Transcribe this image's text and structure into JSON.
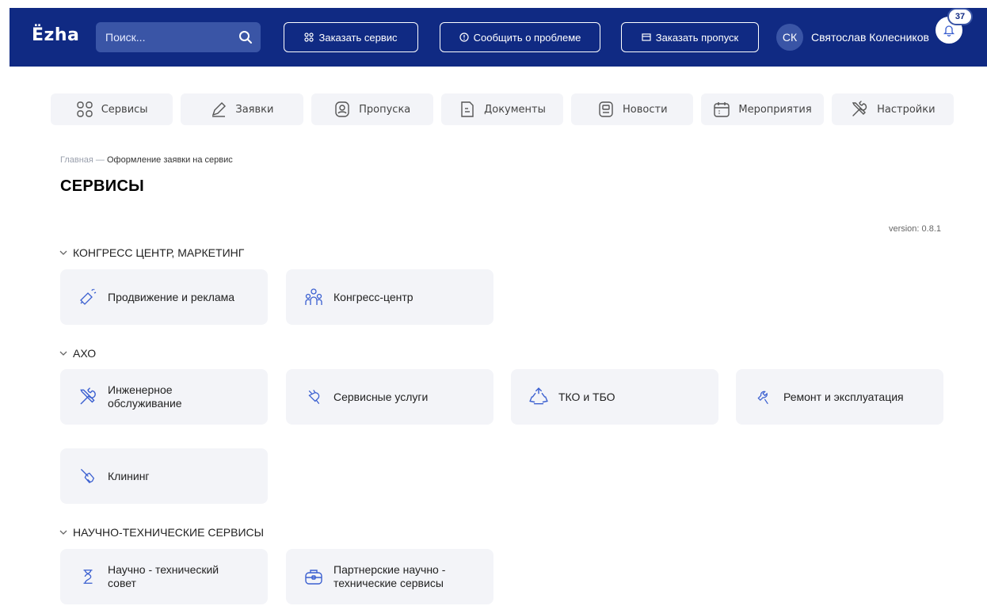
{
  "header": {
    "logo": "Ëzha",
    "search": {
      "placeholder": "Поиск...",
      "value": ""
    },
    "buttons": [
      {
        "label": "Заказать сервис",
        "icon": "grid-icon"
      },
      {
        "label": "Сообщить о проблеме",
        "icon": "alert-circle-icon"
      },
      {
        "label": "Заказать пропуск",
        "icon": "pass-icon"
      }
    ],
    "user": {
      "initials": "СК",
      "name": "Святослав Колесников"
    },
    "notifications": {
      "count": "37",
      "icon": "bell-icon"
    }
  },
  "nav": {
    "tabs": [
      {
        "label": "Сервисы",
        "icon": "grid-icon"
      },
      {
        "label": "Заявки",
        "icon": "pencil-icon"
      },
      {
        "label": "Пропуска",
        "icon": "user-card-icon"
      },
      {
        "label": "Документы",
        "icon": "document-icon"
      },
      {
        "label": "Новости",
        "icon": "news-icon"
      },
      {
        "label": "Мероприятия",
        "icon": "calendar-icon"
      },
      {
        "label": "Настройки",
        "icon": "tools-icon"
      }
    ]
  },
  "breadcrumb": {
    "home": "Главная",
    "separator": " — ",
    "current": "Оформление заявки на сервис"
  },
  "page": {
    "title": "СЕРВИСЫ",
    "version": "version: 0.8.1"
  },
  "sections": [
    {
      "title": "КОНГРЕСС ЦЕНТР, МАРКЕТИНГ",
      "items": [
        {
          "label": "Продвижение и реклама",
          "icon": "megaphone-icon"
        },
        {
          "label": "Конгресс-центр",
          "icon": "people-icon"
        }
      ]
    },
    {
      "title": "АХО",
      "items": [
        {
          "label": "Инженерное обслуживание",
          "icon": "tools-icon"
        },
        {
          "label": "Сервисные услуги",
          "icon": "plug-icon"
        },
        {
          "label": "ТКО и ТБО",
          "icon": "recycle-icon"
        },
        {
          "label": "Ремонт и эксплуатация",
          "icon": "wrench-icon"
        },
        {
          "label": "Клининг",
          "icon": "broom-icon"
        }
      ]
    },
    {
      "title": "НАУЧНО-ТЕХНИЧЕСКИЕ СЕРВИСЫ",
      "items": [
        {
          "label": "Научно - технический совет",
          "icon": "flask-icon"
        },
        {
          "label": "Партнерские научно - технические сервисы",
          "icon": "briefcase-icon"
        }
      ]
    }
  ],
  "colors": {
    "header_bg": "#102a83",
    "accent": "#3a55a6",
    "card_bg": "#f3f4f8",
    "icon": "#3a5fd0"
  }
}
